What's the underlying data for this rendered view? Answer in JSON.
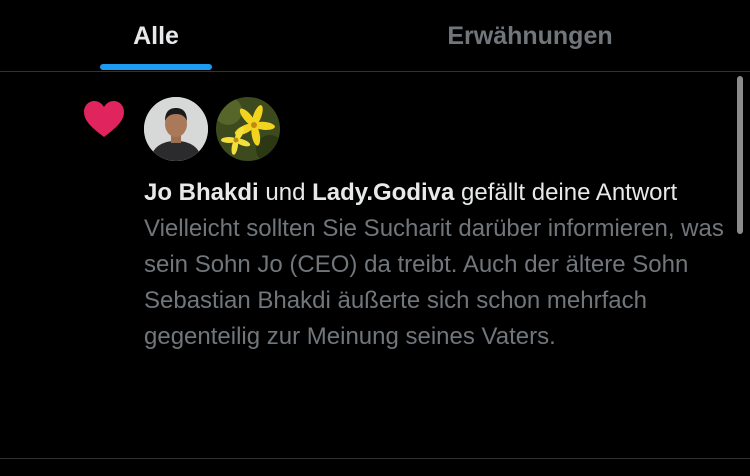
{
  "tabs": {
    "all_label": "Alle",
    "mentions_label": "Erwähnungen",
    "active": "Alle"
  },
  "notification": {
    "user1": "Jo Bhakdi",
    "connector": " und ",
    "user2": "Lady.Godiva",
    "action": " gefällt deine Antwort",
    "reply_text": "Vielleicht sollten Sie Sucharit darüber informieren, was sein Sohn Jo (CEO) da treibt. Auch der ältere Sohn Sebastian Bhakdi äußerte sich schon mehrfach gegenteilig zur Meinung seines Vaters.",
    "icon": "heart-icon"
  },
  "colors": {
    "accent": "#1d9bf0",
    "like": "#f91880",
    "muted_text": "#71767b",
    "background": "#000000"
  }
}
